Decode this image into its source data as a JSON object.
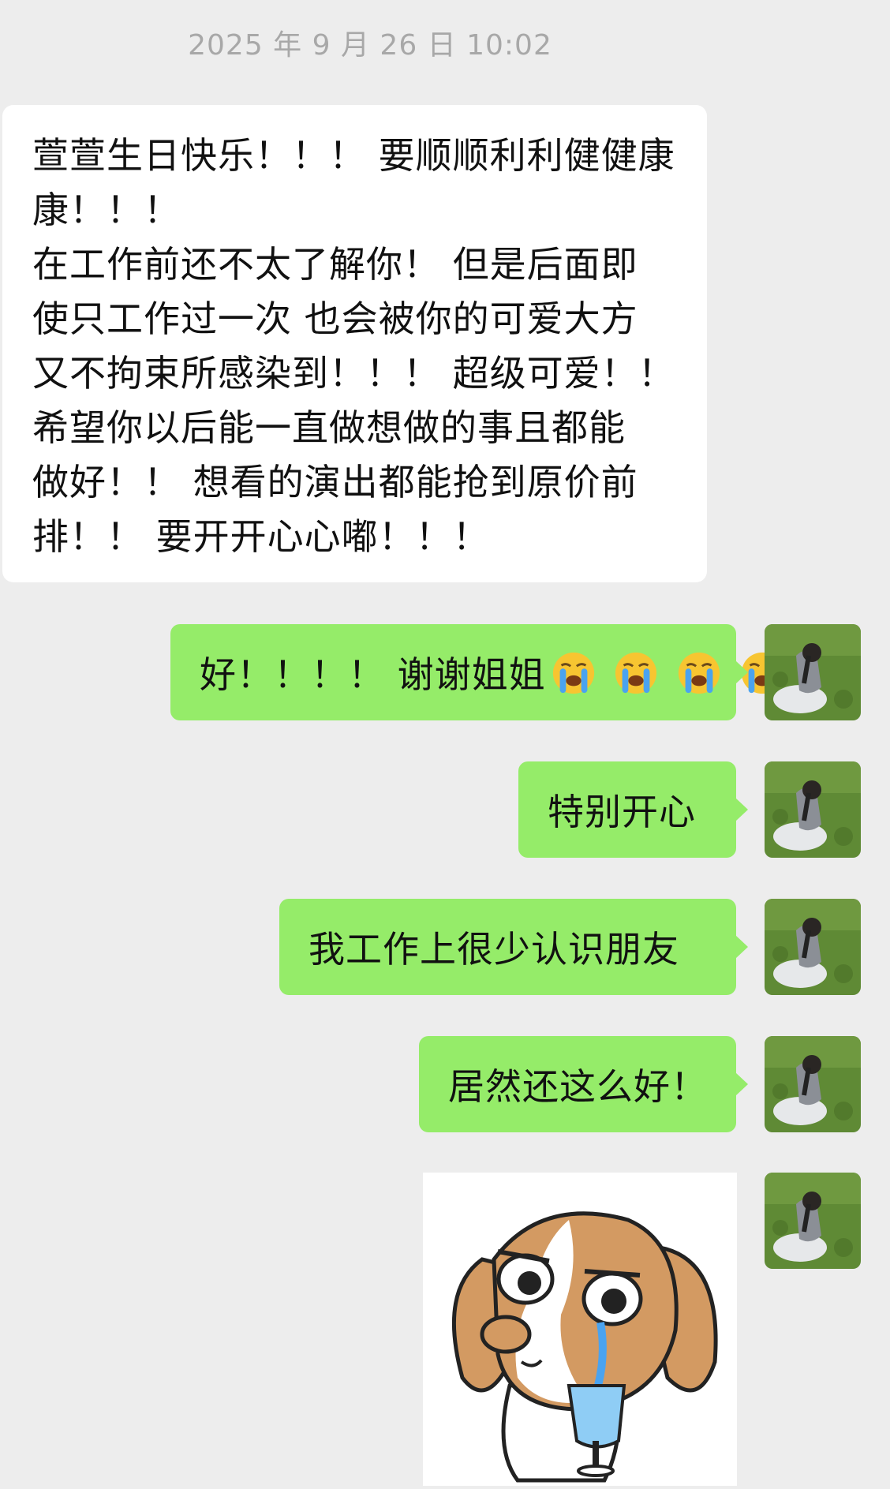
{
  "chat": {
    "timestamp": "2025 年 9 月 26 日 10:02",
    "incoming": {
      "lines": [
        "萱萱生日快乐！！！ 要顺顺利利健健康",
        "康！！！",
        "在工作前还不太了解你！ 但是后面即",
        "使只工作过一次 也会被你的可爱大方",
        "又不拘束所感染到！！！ 超级可爱！！",
        "希望你以后能一直做想做的事且都能",
        "做好！！ 想看的演出都能抢到原价前",
        "排！！ 要开开心心嘟！！！"
      ]
    },
    "outgoing": [
      {
        "text": "好！！！！ 谢谢姐姐",
        "emoji": [
          "loudly-crying-face-icon",
          "loudly-crying-face-icon",
          "loudly-crying-face-icon",
          "loudly-crying-face-icon"
        ]
      },
      {
        "text": "特别开心"
      },
      {
        "text": "我工作上很少认识朋友"
      },
      {
        "text": "居然还这么好！"
      }
    ],
    "sticker": {
      "icon": "crying-dog-sticker-icon"
    },
    "avatar": {
      "icon": "girl-on-grass-avatar-icon"
    }
  },
  "colors": {
    "background": "#ededed",
    "incoming_bubble": "#ffffff",
    "outgoing_bubble": "#95ec69",
    "timestamp_text": "#a8a8a8"
  }
}
